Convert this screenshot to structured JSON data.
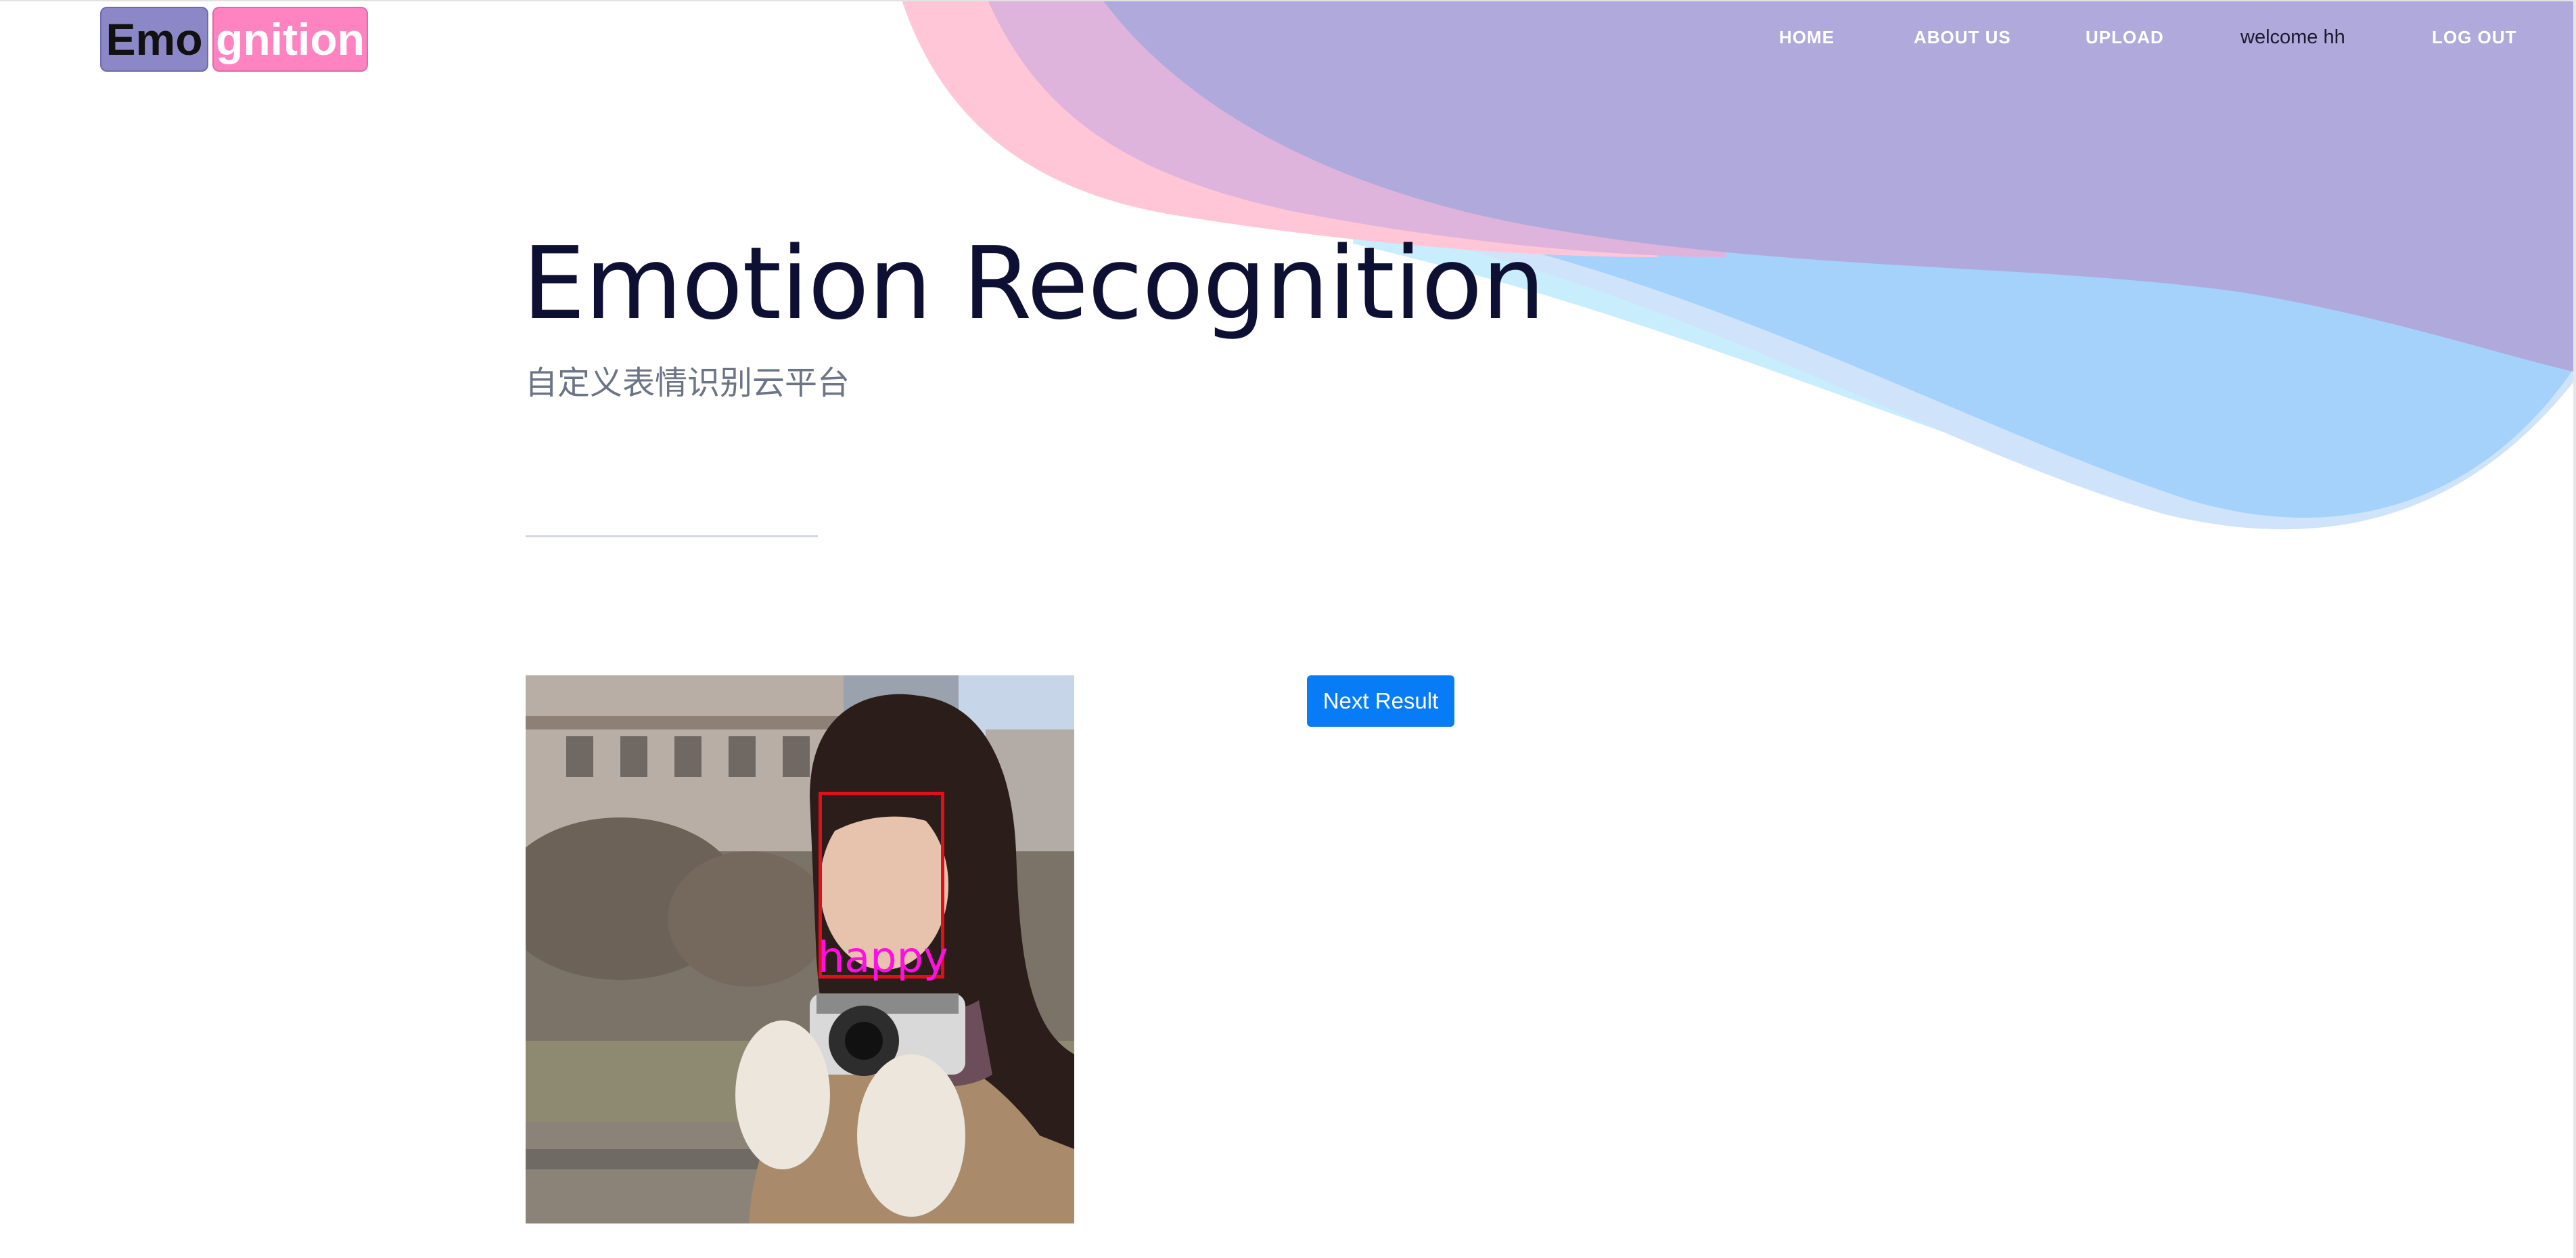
{
  "logo": {
    "part1": "Emo",
    "part2": "gnition"
  },
  "nav": {
    "home": "HOME",
    "about": "ABOUT US",
    "upload": "UPLOAD",
    "welcome": "welcome hh",
    "logout": "LOG OUT"
  },
  "hero": {
    "title": "Emotion Recognition",
    "subtitle": "自定义表情识别云平台"
  },
  "result": {
    "emotion_label": "happy",
    "next_button": "Next Result"
  },
  "colors": {
    "primary_button": "#087cf6",
    "title_text": "#0e1033",
    "wave_purple": "#b0a9dc",
    "wave_pink": "#ffc6d8",
    "wave_blue": "#a4d2fb",
    "face_box": "#e0101a",
    "emotion_label": "#ff10e0"
  }
}
